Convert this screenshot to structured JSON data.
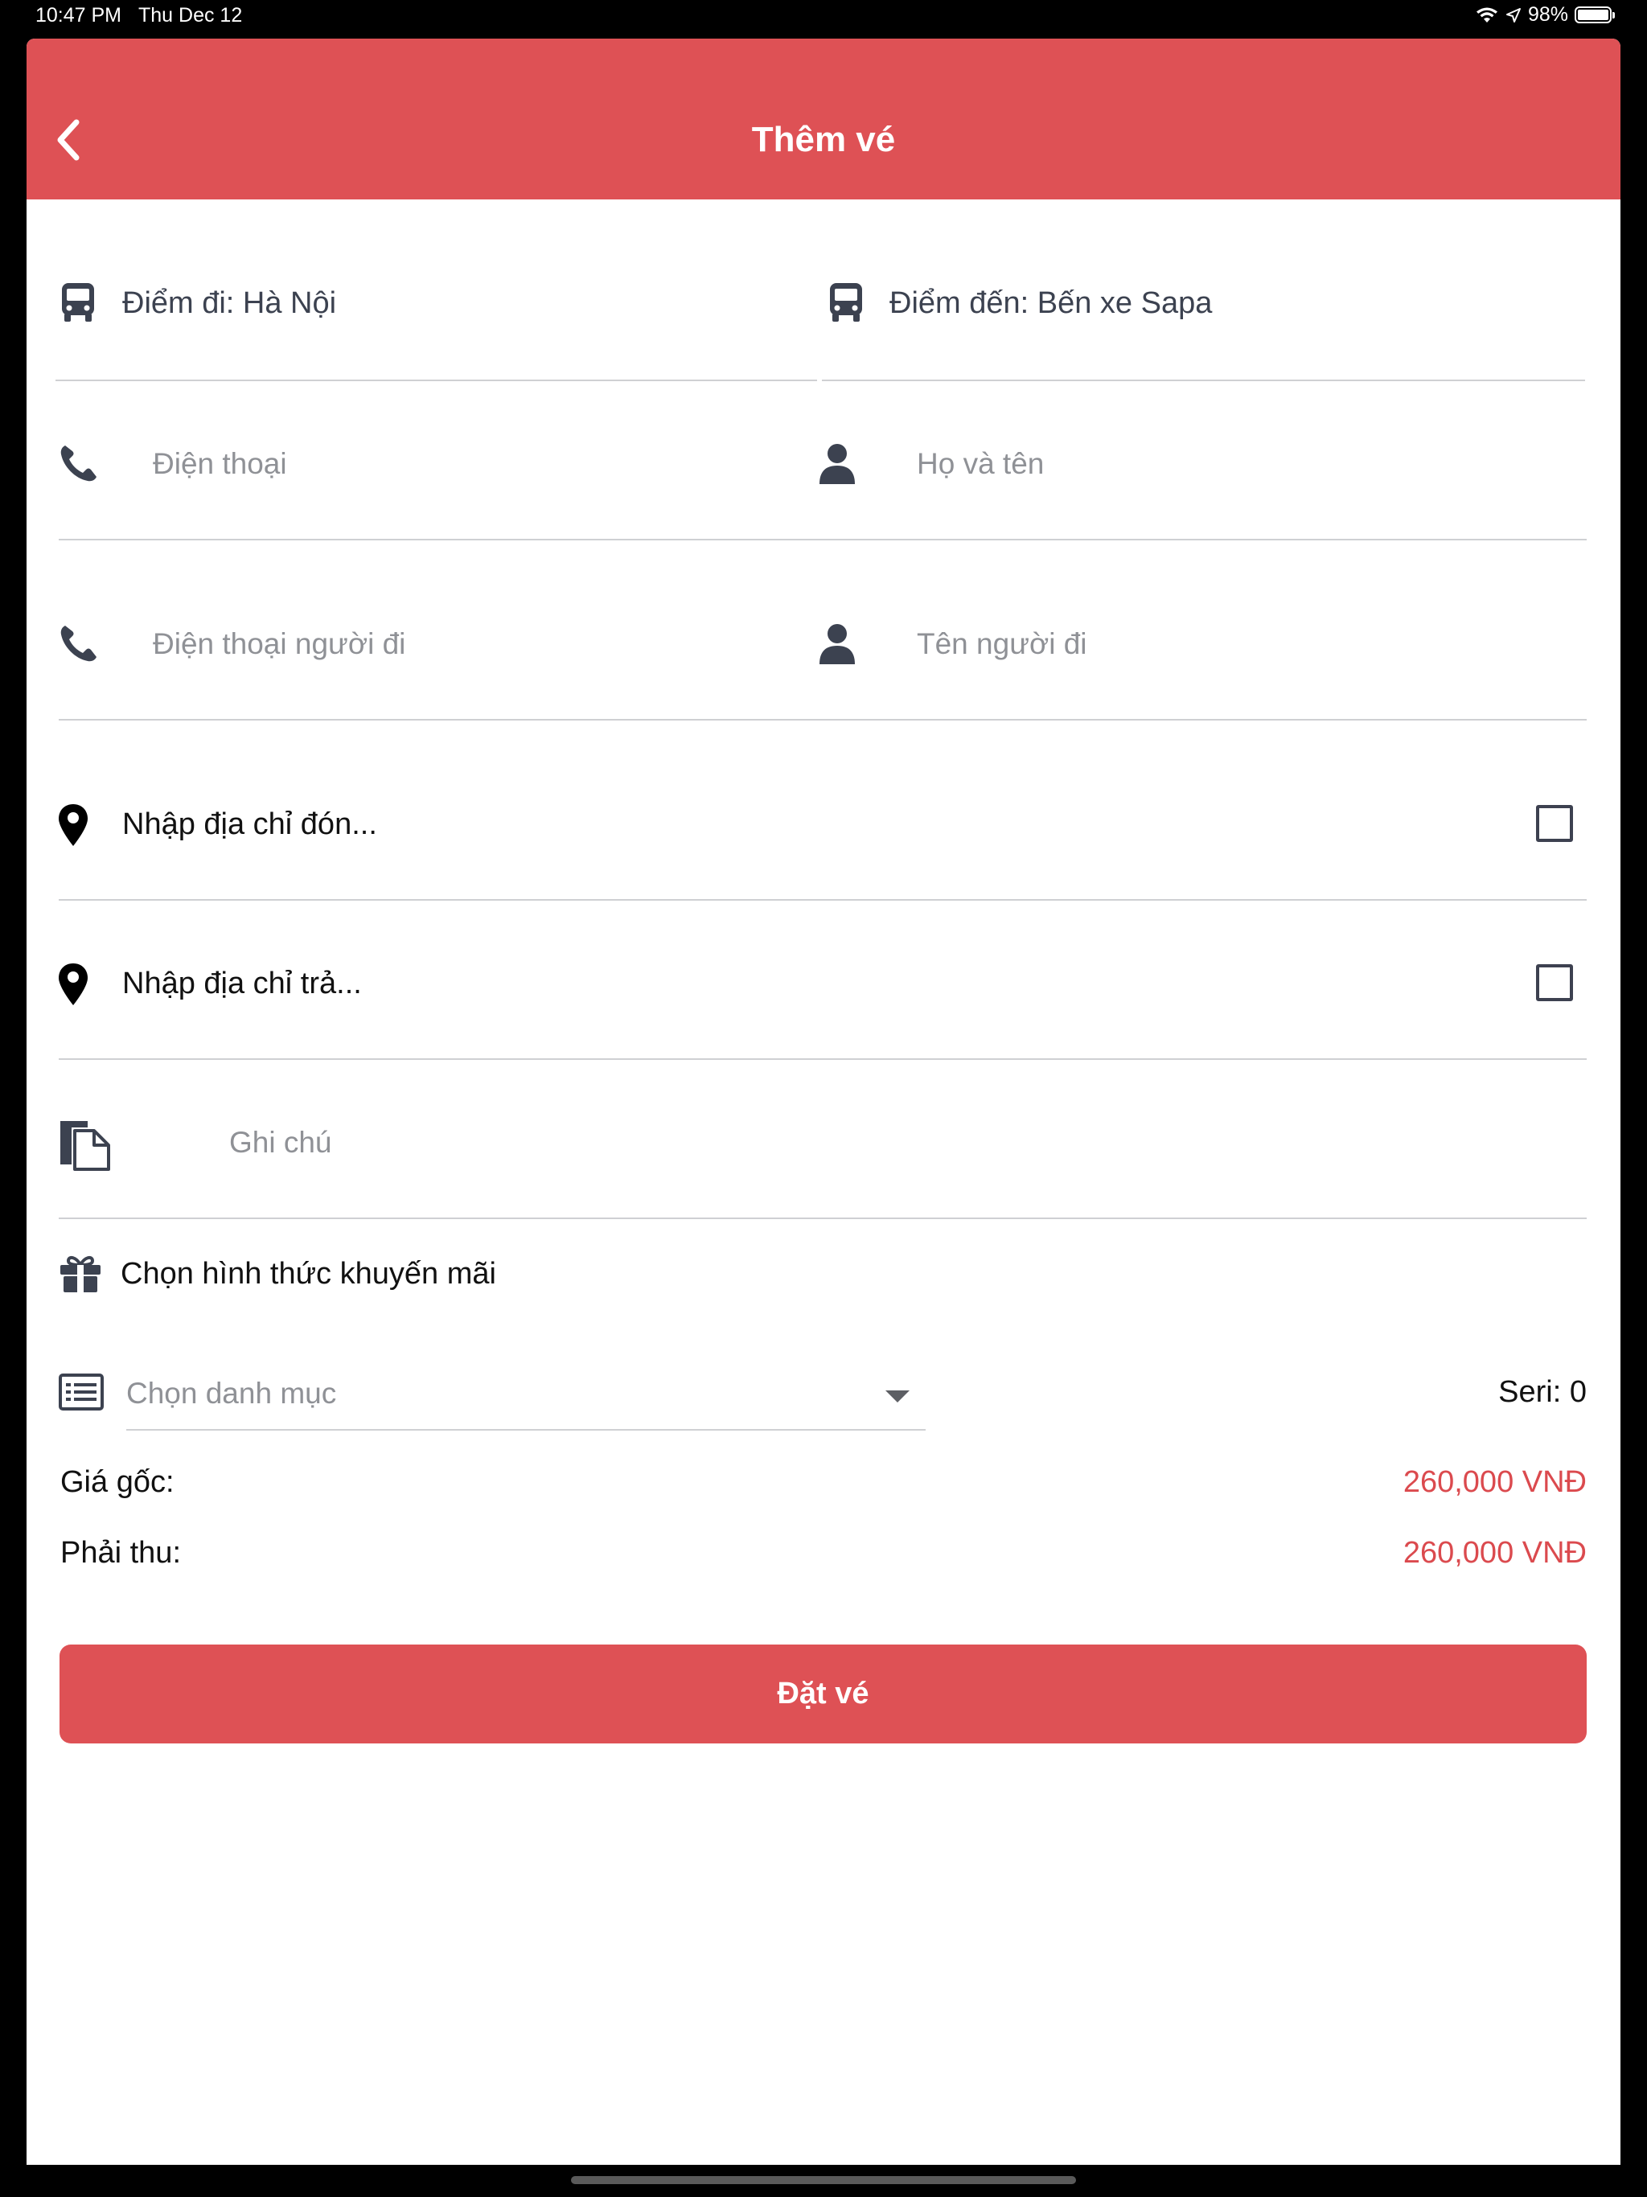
{
  "status_bar": {
    "time": "10:47 PM",
    "date": "Thu Dec 12",
    "battery": "98%"
  },
  "header": {
    "title": "Thêm vé"
  },
  "route": {
    "from": "Điểm đi: Hà Nội",
    "to": "Điểm đến: Bến xe Sapa"
  },
  "contact": {
    "phone_placeholder": "Điện thoại",
    "name_placeholder": "Họ và tên",
    "passenger_phone_placeholder": "Điện thoại người đi",
    "passenger_name_placeholder": "Tên người đi"
  },
  "address": {
    "pickup": "Nhập địa chỉ đón...",
    "dropoff": "Nhập địa chỉ trả..."
  },
  "note": {
    "placeholder": "Ghi chú"
  },
  "promotion": {
    "label": "Chọn hình thức khuyến mãi"
  },
  "category": {
    "placeholder": "Chọn danh mục",
    "seri": "Seri: 0"
  },
  "price": {
    "original_label": "Giá gốc:",
    "original_value": "260,000 VNĐ",
    "due_label": "Phải thu:",
    "due_value": "260,000 VNĐ"
  },
  "actions": {
    "book": "Đặt vé"
  },
  "colors": {
    "primary": "#de5155",
    "price": "#db4a4e",
    "icon": "#3c4250"
  }
}
